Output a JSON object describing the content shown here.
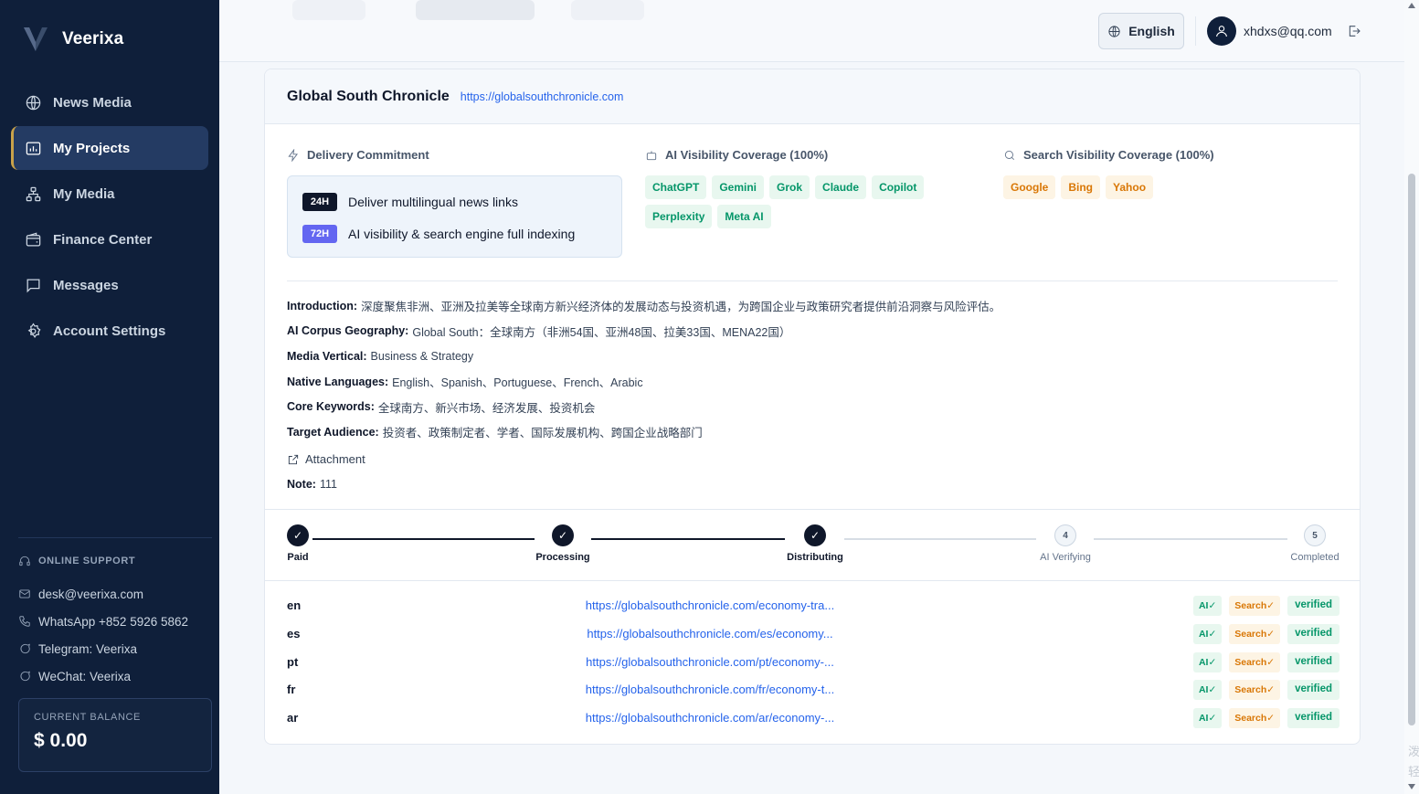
{
  "brand": {
    "name": "Veerixa"
  },
  "sidebar": {
    "items": [
      {
        "label": "News Media",
        "icon": "globe-icon",
        "active": false
      },
      {
        "label": "My Projects",
        "icon": "projects-icon",
        "active": true
      },
      {
        "label": "My Media",
        "icon": "network-icon",
        "active": false
      },
      {
        "label": "Finance Center",
        "icon": "wallet-icon",
        "active": false
      },
      {
        "label": "Messages",
        "icon": "message-icon",
        "active": false
      },
      {
        "label": "Account Settings",
        "icon": "gear-icon",
        "active": false
      }
    ],
    "support": {
      "title": "ONLINE SUPPORT",
      "email": "desk@veerixa.com",
      "whatsapp": "WhatsApp +852 5926 5862",
      "telegram": "Telegram: Veerixa",
      "wechat": "WeChat: Veerixa"
    },
    "balance": {
      "label": "CURRENT BALANCE",
      "value": "$ 0.00"
    }
  },
  "header": {
    "language": "English",
    "user_email": "xhdxs@qq.com"
  },
  "project": {
    "title": "Global South Chronicle",
    "url": "https://globalsouthchronicle.com",
    "delivery": {
      "title": "Delivery Commitment",
      "items": [
        {
          "badge": "24H",
          "text": "Deliver multilingual news links"
        },
        {
          "badge": "72H",
          "text": "AI visibility & search engine full indexing"
        }
      ]
    },
    "ai_coverage": {
      "title": "AI Visibility Coverage (100%)",
      "tags": [
        "ChatGPT",
        "Gemini",
        "Grok",
        "Claude",
        "Copilot",
        "Perplexity",
        "Meta AI"
      ]
    },
    "search_coverage": {
      "title": "Search Visibility Coverage (100%)",
      "tags": [
        "Google",
        "Bing",
        "Yahoo"
      ]
    },
    "info": [
      {
        "label": "Introduction:",
        "value": "深度聚焦非洲、亚洲及拉美等全球南方新兴经济体的发展动态与投资机遇，为跨国企业与政策研究者提供前沿洞察与风险评估。"
      },
      {
        "label": "AI Corpus Geography:",
        "value": "Global South：全球南方（非洲54国、亚洲48国、拉美33国、MENA22国）"
      },
      {
        "label": "Media Vertical:",
        "value": "Business & Strategy"
      },
      {
        "label": "Native Languages:",
        "value": "English、Spanish、Portuguese、French、Arabic"
      },
      {
        "label": "Core Keywords:",
        "value": "全球南方、新兴市场、经济发展、投资机会"
      },
      {
        "label": "Target Audience:",
        "value": "投资者、政策制定者、学者、国际发展机构、跨国企业战略部门"
      }
    ],
    "attachment_label": "Attachment",
    "note": {
      "label": "Note:",
      "value": "111"
    },
    "steps": [
      {
        "marker": "✓",
        "label": "Paid",
        "done": true
      },
      {
        "marker": "✓",
        "label": "Processing",
        "done": true
      },
      {
        "marker": "✓",
        "label": "Distributing",
        "done": true
      },
      {
        "marker": "4",
        "label": "AI Verifying",
        "done": false
      },
      {
        "marker": "5",
        "label": "Completed",
        "done": false
      }
    ],
    "links": [
      {
        "lang": "en",
        "url": "https://globalsouthchronicle.com/economy-tra...",
        "ai": "AI✓",
        "search": "Search✓",
        "status": "verified"
      },
      {
        "lang": "es",
        "url": "https://globalsouthchronicle.com/es/economy...",
        "ai": "AI✓",
        "search": "Search✓",
        "status": "verified"
      },
      {
        "lang": "pt",
        "url": "https://globalsouthchronicle.com/pt/economy-...",
        "ai": "AI✓",
        "search": "Search✓",
        "status": "verified"
      },
      {
        "lang": "fr",
        "url": "https://globalsouthchronicle.com/fr/economy-t...",
        "ai": "AI✓",
        "search": "Search✓",
        "status": "verified"
      },
      {
        "lang": "ar",
        "url": "https://globalsouthchronicle.com/ar/economy-...",
        "ai": "AI✓",
        "search": "Search✓",
        "status": "verified"
      }
    ]
  },
  "side_text": "泼 轻",
  "colors": {
    "sidebar_bg": "#0f1f3a",
    "active_accent": "#c9a24a",
    "link": "#2563eb",
    "ai_green": "#059669",
    "search_orange": "#d97706"
  }
}
